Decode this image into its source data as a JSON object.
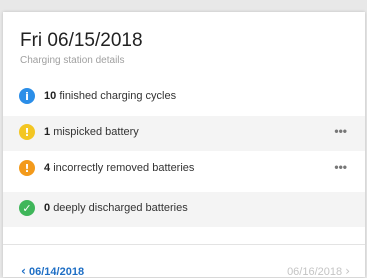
{
  "header": {
    "title": "Fri 06/15/2018",
    "subtitle": "Charging station details"
  },
  "rows": [
    {
      "count": "10",
      "label": "finished charging cycles",
      "icon": "info-icon",
      "icon_glyph": "i",
      "color": "#2b8ee8",
      "has_more": false
    },
    {
      "count": "1",
      "label": "mispicked battery",
      "icon": "warning-icon",
      "icon_glyph": "!",
      "color": "#f3c623",
      "has_more": true,
      "more_label": "•••"
    },
    {
      "count": "4",
      "label": "incorrectly removed batteries",
      "icon": "alert-icon",
      "icon_glyph": "!",
      "color": "#f39a1b",
      "has_more": true,
      "more_label": "•••"
    },
    {
      "count": "0",
      "label": "deeply discharged batteries",
      "icon": "check-icon",
      "icon_glyph": "✓",
      "color": "#3fb65a",
      "has_more": false
    }
  ],
  "nav": {
    "prev_label": "06/14/2018",
    "prev_icon": "chevron-left-icon",
    "prev_glyph": "‹",
    "next_label": "06/16/2018",
    "next_icon": "chevron-right-icon",
    "next_glyph": "›"
  },
  "colors": {
    "accent": "#1f6fc5",
    "disabled": "#c4c4c4"
  }
}
